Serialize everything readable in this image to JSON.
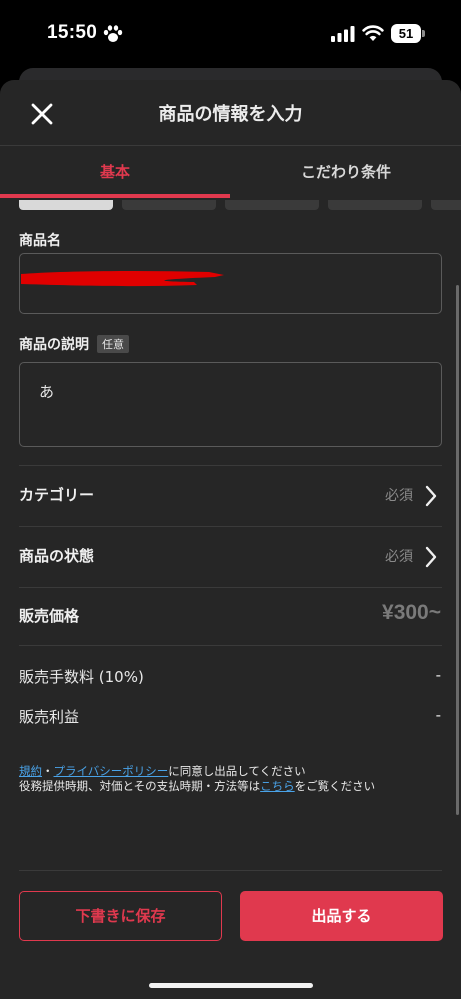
{
  "status_bar": {
    "time": "15:50",
    "battery": "51"
  },
  "header": {
    "title": "商品の情報を入力"
  },
  "tabs": [
    {
      "label": "基本",
      "active": true
    },
    {
      "label": "こだわり条件",
      "active": false
    }
  ],
  "form": {
    "name_label": "商品名",
    "description_label": "商品の説明",
    "optional_badge": "任意",
    "description_value": "あ"
  },
  "rows": {
    "category": {
      "label": "カテゴリー",
      "required": "必須"
    },
    "condition": {
      "label": "商品の状態",
      "required": "必須"
    },
    "price": {
      "label": "販売価格",
      "value": "¥300~"
    }
  },
  "fees": {
    "fee_label": "販売手数料 (10%)",
    "fee_value": "-",
    "profit_label": "販売利益",
    "profit_value": "-"
  },
  "terms": {
    "link_terms": "規約",
    "sep": "・",
    "link_privacy": "プライバシーポリシー",
    "text1": "に同意し出品してください",
    "text2": "役務提供時期、対価とその支払時期・方法等は",
    "link_here": "こちら",
    "text3": "をご覧ください"
  },
  "buttons": {
    "draft": "下書きに保存",
    "list": "出品する"
  },
  "colors": {
    "accent": "#e0394e",
    "link": "#4aa3e8",
    "sheet": "#262626"
  }
}
